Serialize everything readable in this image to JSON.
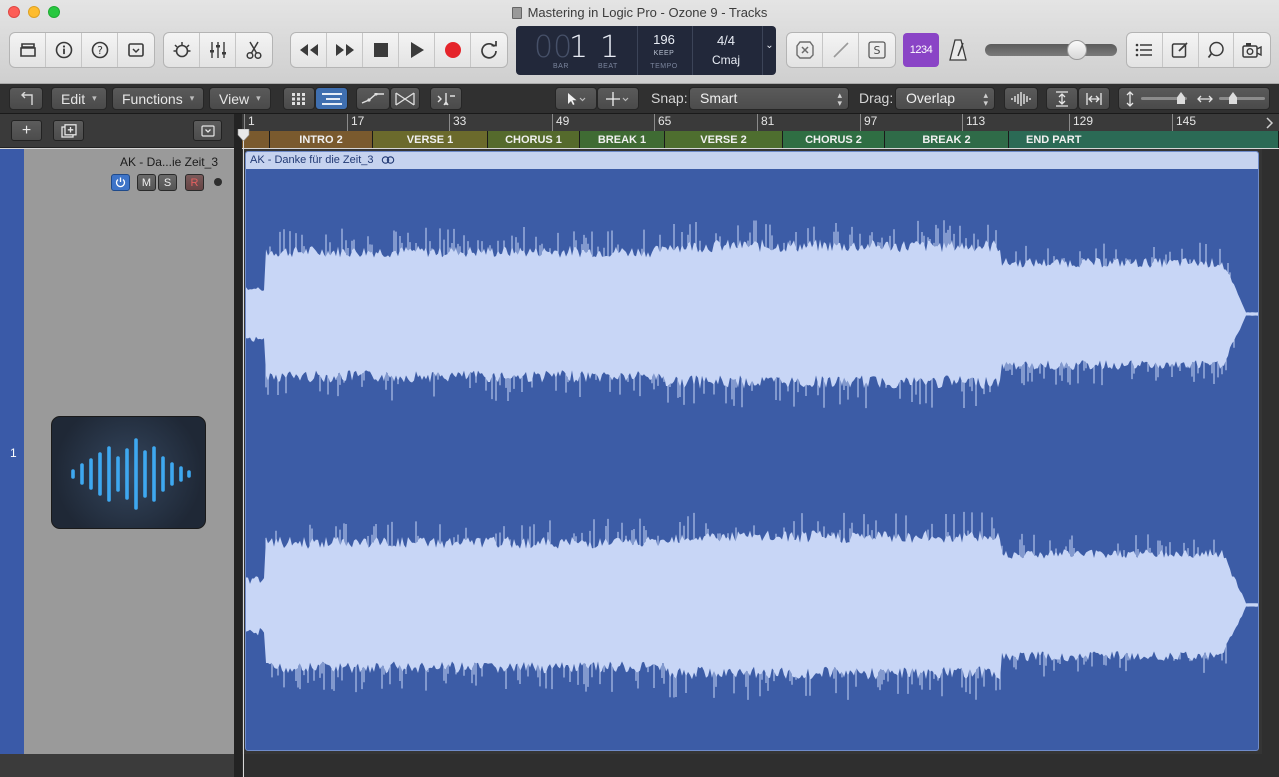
{
  "window": {
    "title": "Mastering in Logic Pro - Ozone 9 - Tracks"
  },
  "lcd": {
    "bar_prefix": "00",
    "bar": "1",
    "beat": "1",
    "bar_label": "BAR",
    "beat_label": "BEAT",
    "tempo": "196",
    "tempo_mode": "KEEP",
    "tempo_label": "TEMPO",
    "signature": "4/4",
    "key": "Cmaj"
  },
  "count_in": "1234",
  "edit_toolbar": {
    "edit": "Edit",
    "functions": "Functions",
    "view": "View",
    "snap_label": "Snap:",
    "snap_value": "Smart",
    "drag_label": "Drag:",
    "drag_value": "Overlap"
  },
  "ruler": [
    "1",
    "17",
    "33",
    "49",
    "65",
    "81",
    "97",
    "113",
    "129",
    "145"
  ],
  "markers": [
    "INTRO 2",
    "VERSE 1",
    "CHORUS 1",
    "BREAK 1",
    "VERSE 2",
    "CHORUS 2",
    "BREAK 2",
    "END PART"
  ],
  "colors": {
    "marker_intro": "#7a5a2e",
    "marker_verse": "#6b6a2c",
    "marker_chorus": "#556a2c",
    "marker_break": "#3f6b33",
    "marker_verse2": "#4e6e2f",
    "marker_chorus2": "#2f6e43",
    "marker_break2": "#2f6b48",
    "marker_end": "#2b6a55",
    "region_bg": "#3c5ca6",
    "waveform": "#c8d6f6"
  },
  "track": {
    "number": "1",
    "name": "AK - Da...ie Zeit_3",
    "mute": "M",
    "solo": "S",
    "record": "R",
    "icon": "waveform-icon"
  },
  "region": {
    "title": "AK - Danke für die Zeit_3"
  }
}
